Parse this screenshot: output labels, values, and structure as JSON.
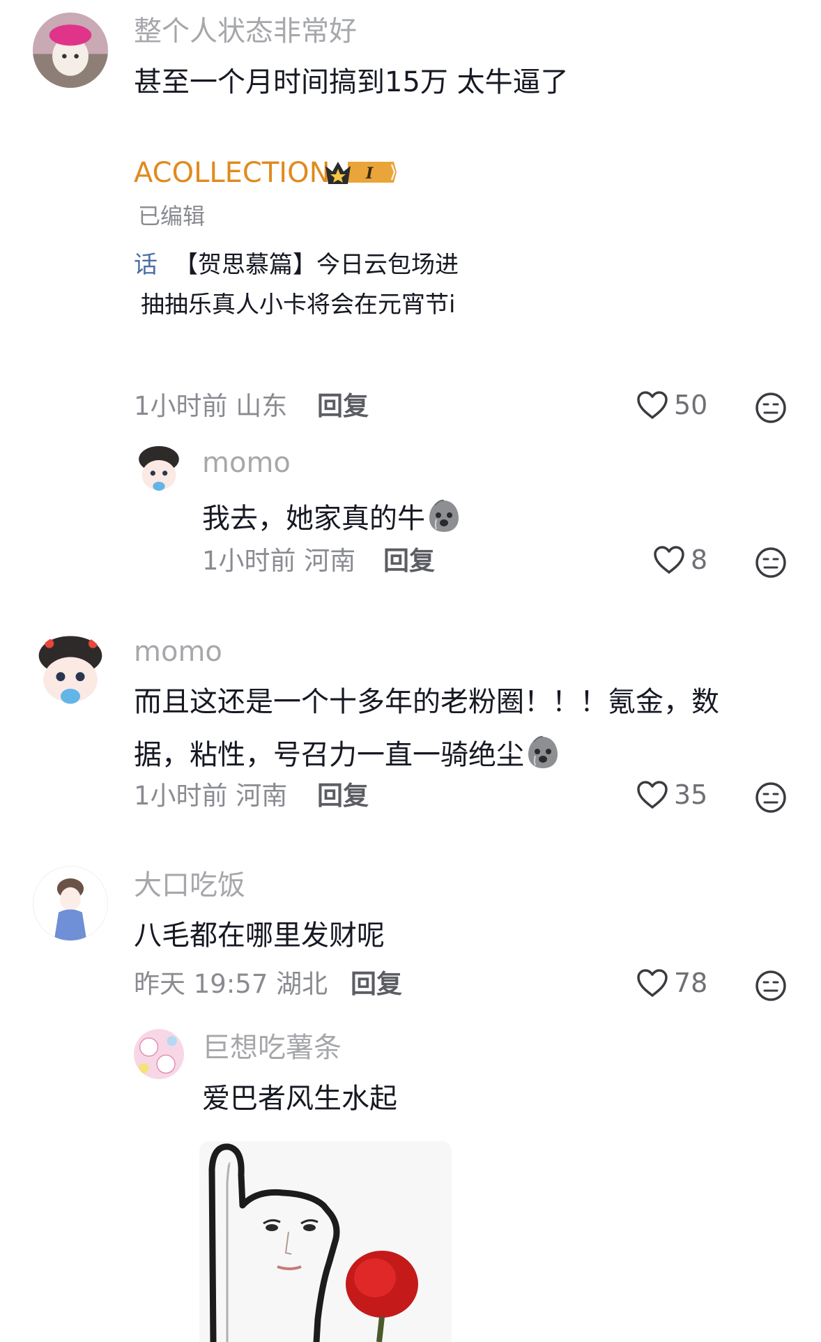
{
  "comments": [
    {
      "username": "整个人状态非常好",
      "text": "甚至一个月时间搞到15万 太牛逼了",
      "card": {
        "brand": "ACOLLECTION",
        "badge_level": "I",
        "edited": "已编辑",
        "line1_prefix": "话",
        "line1": "【贺思慕篇】今日云包场进",
        "line2": "抽抽乐真人小卡将会在元宵节i"
      },
      "time_loc": "1小时前 山东",
      "reply_label": "回复",
      "likes": "50",
      "replies": [
        {
          "username": "momo",
          "text": "我去，她家真的牛",
          "time_loc": "1小时前 河南",
          "reply_label": "回复",
          "likes": "8"
        }
      ]
    },
    {
      "username": "momo",
      "text_line1": "而且这还是一个十多年的老粉圈！！！氪金，数",
      "text_line2": "据，粘性，号召力一直一骑绝尘",
      "time_loc": "1小时前 河南",
      "reply_label": "回复",
      "likes": "35"
    },
    {
      "username": "大口吃饭",
      "text": "八毛都在哪里发财呢",
      "time_loc": "昨天 19:57 湖北",
      "reply_label": "回复",
      "likes": "78",
      "replies": [
        {
          "username": "巨想吃薯条",
          "text": "爱巴者风生水起"
        }
      ]
    }
  ],
  "colors": {
    "brand_orange": "#e08a1e",
    "username_gray": "#a6a7ab",
    "text_dark": "#161823",
    "meta_gray": "#8a8b91"
  },
  "icons": [
    "heart-icon",
    "dislike-face-icon",
    "crying-emoji-icon",
    "crown-icon"
  ]
}
